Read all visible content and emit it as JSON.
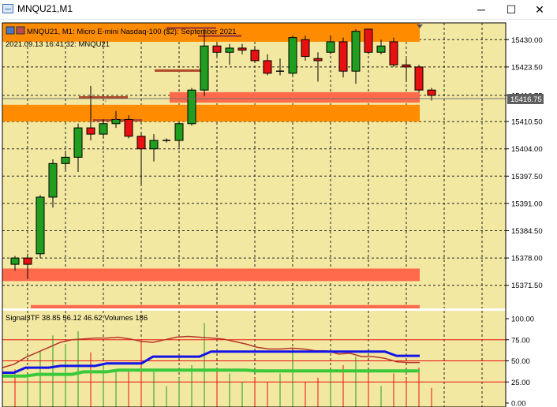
{
  "window": {
    "title": "MNQU21,M1",
    "minimize_glyph": "─",
    "maximize_glyph": "☐",
    "close_glyph": "✕"
  },
  "chart_header": {
    "symbol_line": "MNQU21, M1:  Micro E-mini Nasdaq-100 ($2): September 2021",
    "time_line": "2021.09.13 16:41:32: MNQU21"
  },
  "colors": {
    "background": "#f3e8a1",
    "grid": "#222222",
    "bull": "#1f9e1f",
    "bear": "#e81010",
    "zone_orange": "#ff8c00",
    "zone_salmon": "#ff6a4d",
    "price_tag_bg": "#5f5f5f"
  },
  "price_axis": {
    "ticks": [
      "15430.00",
      "15423.50",
      "15416.75",
      "15410.50",
      "15404.00",
      "15397.50",
      "15391.00",
      "15384.50",
      "15378.00",
      "15371.50"
    ],
    "current_price_label": "15416.75"
  },
  "indicator": {
    "label": "Signal3TF 38.85 56.12 46.62 Volumes 186",
    "ticks": [
      "100.00",
      "75.00",
      "50.00",
      "25.00",
      "0.00"
    ],
    "levels": [
      75,
      50,
      25
    ]
  },
  "chart_data": {
    "type": "candlestick",
    "symbol": "MNQU21",
    "timeframe": "M1",
    "ylim": [
      15366,
      15434
    ],
    "current_price": 15416.75,
    "candles": [
      {
        "o": 15376.5,
        "h": 15378.5,
        "l": 15375.0,
        "c": 15378.0
      },
      {
        "o": 15378.0,
        "h": 15379.0,
        "l": 15373.0,
        "c": 15376.5
      },
      {
        "o": 15379.0,
        "h": 15393.0,
        "l": 15378.0,
        "c": 15392.5
      },
      {
        "o": 15392.5,
        "h": 15401.5,
        "l": 15390.0,
        "c": 15400.5
      },
      {
        "o": 15400.5,
        "h": 15403.5,
        "l": 15399.0,
        "c": 15402.0
      },
      {
        "o": 15402.0,
        "h": 15410.0,
        "l": 15398.5,
        "c": 15409.0
      },
      {
        "o": 15409.0,
        "h": 15419.0,
        "l": 15406.0,
        "c": 15407.5
      },
      {
        "o": 15407.5,
        "h": 15411.0,
        "l": 15406.5,
        "c": 15410.0
      },
      {
        "o": 15410.0,
        "h": 15413.0,
        "l": 15409.0,
        "c": 15411.0
      },
      {
        "o": 15411.0,
        "h": 15412.0,
        "l": 15406.5,
        "c": 15407.0
      },
      {
        "o": 15407.0,
        "h": 15408.0,
        "l": 15395.5,
        "c": 15404.0
      },
      {
        "o": 15404.0,
        "h": 15407.5,
        "l": 15401.0,
        "c": 15406.0
      },
      {
        "o": 15406.0,
        "h": 15406.5,
        "l": 15405.5,
        "c": 15406.0
      },
      {
        "o": 15406.0,
        "h": 15410.5,
        "l": 15404.5,
        "c": 15410.0
      },
      {
        "o": 15410.0,
        "h": 15418.5,
        "l": 15409.5,
        "c": 15418.0
      },
      {
        "o": 15418.0,
        "h": 15432.5,
        "l": 15416.5,
        "c": 15428.5
      },
      {
        "o": 15428.5,
        "h": 15429.5,
        "l": 15426.0,
        "c": 15427.0
      },
      {
        "o": 15427.0,
        "h": 15429.0,
        "l": 15424.0,
        "c": 15428.0
      },
      {
        "o": 15428.0,
        "h": 15429.0,
        "l": 15426.5,
        "c": 15427.5
      },
      {
        "o": 15427.5,
        "h": 15428.5,
        "l": 15424.5,
        "c": 15425.0
      },
      {
        "o": 15425.0,
        "h": 15426.5,
        "l": 15421.5,
        "c": 15422.0
      },
      {
        "o": 15422.5,
        "h": 15425.5,
        "l": 15421.5,
        "c": 15422.5
      },
      {
        "o": 15422.0,
        "h": 15431.0,
        "l": 15421.5,
        "c": 15430.5
      },
      {
        "o": 15430.0,
        "h": 15431.0,
        "l": 15425.0,
        "c": 15426.0
      },
      {
        "o": 15425.5,
        "h": 15427.0,
        "l": 15420.0,
        "c": 15425.0
      },
      {
        "o": 15427.0,
        "h": 15431.0,
        "l": 15426.5,
        "c": 15429.5
      },
      {
        "o": 15429.5,
        "h": 15430.5,
        "l": 15421.0,
        "c": 15422.5
      },
      {
        "o": 15422.5,
        "h": 15432.5,
        "l": 15419.5,
        "c": 15432.0
      },
      {
        "o": 15432.5,
        "h": 15432.5,
        "l": 15426.5,
        "c": 15427.0
      },
      {
        "o": 15427.0,
        "h": 15430.0,
        "l": 15426.5,
        "c": 15428.5
      },
      {
        "o": 15429.5,
        "h": 15430.5,
        "l": 15423.5,
        "c": 15424.0
      },
      {
        "o": 15424.0,
        "h": 15425.5,
        "l": 15420.0,
        "c": 15423.5
      },
      {
        "o": 15423.5,
        "h": 15424.0,
        "l": 15417.5,
        "c": 15418.0
      },
      {
        "o": 15418.0,
        "h": 15418.5,
        "l": 15415.5,
        "c": 15416.75
      }
    ],
    "zones": [
      {
        "y1": 15429.5,
        "y2": 15434.0,
        "x_from": 0,
        "color": "orange"
      },
      {
        "y1": 15417.5,
        "y2": 15415.0,
        "x_from": 13,
        "color": "salmon"
      },
      {
        "y1": 15414.5,
        "y2": 15410.5,
        "x_from": 0,
        "color": "orange"
      },
      {
        "y1": 15375.5,
        "y2": 15372.5,
        "x_from": 0,
        "color": "salmon"
      },
      {
        "y1": 15366.8,
        "y2": 15366.0,
        "x_from": 2,
        "color": "salmon"
      }
    ],
    "indicator_lines": {
      "red": [
        42,
        46,
        54,
        60,
        66,
        72,
        75,
        76,
        77,
        77,
        78,
        76,
        73,
        72,
        75,
        78,
        79,
        78,
        77,
        76,
        73,
        70,
        66,
        64,
        64,
        65,
        64,
        62,
        62,
        58,
        59,
        55,
        55,
        53,
        49,
        48,
        48
      ],
      "blue": [
        36,
        36,
        42,
        42,
        42,
        44,
        44,
        44,
        44,
        47,
        47,
        47,
        47,
        55,
        55,
        55,
        55,
        55,
        61,
        61,
        61,
        61,
        61,
        61,
        61,
        61,
        61,
        61,
        61,
        61,
        61,
        61,
        61,
        61,
        56,
        56,
        56
      ],
      "green": [
        32,
        32,
        32,
        34,
        34,
        34,
        34,
        37,
        37,
        37,
        39,
        39,
        39,
        39,
        39,
        39,
        39,
        39,
        39,
        39,
        39,
        39,
        38,
        38,
        38,
        38,
        38,
        38,
        38,
        38,
        38,
        38,
        38,
        38,
        38,
        38,
        38
      ]
    },
    "volume_bars": [
      {
        "v": 40,
        "c": "bear"
      },
      {
        "v": 33,
        "c": "bull"
      },
      {
        "v": 62,
        "c": "bull"
      },
      {
        "v": 80,
        "c": "bull"
      },
      {
        "v": 70,
        "c": "bull"
      },
      {
        "v": 85,
        "c": "bull"
      },
      {
        "v": 60,
        "c": "bear"
      },
      {
        "v": 45,
        "c": "bull"
      },
      {
        "v": 38,
        "c": "bull"
      },
      {
        "v": 40,
        "c": "bear"
      },
      {
        "v": 75,
        "c": "bear"
      },
      {
        "v": 37,
        "c": "bull"
      },
      {
        "v": 20,
        "c": "bull"
      },
      {
        "v": 30,
        "c": "bull"
      },
      {
        "v": 45,
        "c": "bull"
      },
      {
        "v": 95,
        "c": "bull"
      },
      {
        "v": 40,
        "c": "bear"
      },
      {
        "v": 35,
        "c": "bull"
      },
      {
        "v": 25,
        "c": "bull"
      },
      {
        "v": 30,
        "c": "bear"
      },
      {
        "v": 25,
        "c": "bear"
      },
      {
        "v": 35,
        "c": "bull"
      },
      {
        "v": 60,
        "c": "bull"
      },
      {
        "v": 25,
        "c": "bear"
      },
      {
        "v": 30,
        "c": "bear"
      },
      {
        "v": 40,
        "c": "bull"
      },
      {
        "v": 45,
        "c": "bear"
      },
      {
        "v": 55,
        "c": "bull"
      },
      {
        "v": 35,
        "c": "bear"
      },
      {
        "v": 20,
        "c": "bull"
      },
      {
        "v": 35,
        "c": "bear"
      },
      {
        "v": 30,
        "c": "bear"
      },
      {
        "v": 42,
        "c": "bear"
      },
      {
        "v": 18,
        "c": "bear"
      }
    ]
  }
}
